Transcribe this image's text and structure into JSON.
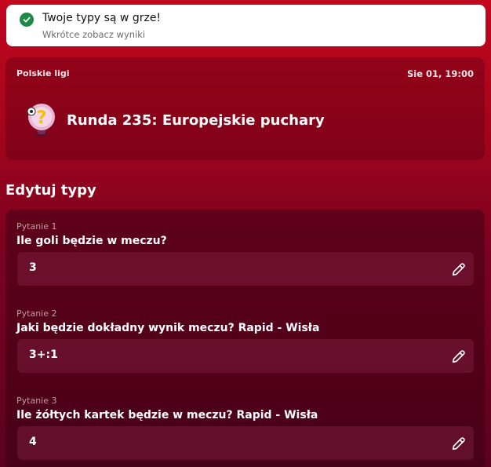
{
  "toast": {
    "title": "Twoje typy są w grze!",
    "subtitle": "Wkrótce zobacz wyniki"
  },
  "round": {
    "league": "Polskie ligi",
    "date": "Sie 01, 19:00",
    "title": "Runda 235: Europejskie puchary"
  },
  "edit": {
    "title": "Edytuj typy"
  },
  "questions": [
    {
      "label": "Pytanie 1",
      "text": "Ile goli będzie w meczu?",
      "answer": "3"
    },
    {
      "label": "Pytanie 2",
      "text": "Jaki będzie dokładny wynik meczu? Rapid - Wisła",
      "answer": "3+:1"
    },
    {
      "label": "Pytanie 3",
      "text": "Ile żółtych kartek będzie w meczu? Rapid - Wisła",
      "answer": "4"
    }
  ],
  "icons": {
    "toast": "check-circle-icon",
    "round": "question-ball-icon",
    "edit": "pencil-icon"
  },
  "colors": {
    "success": "#1e8a47",
    "background": "#b0061e"
  }
}
